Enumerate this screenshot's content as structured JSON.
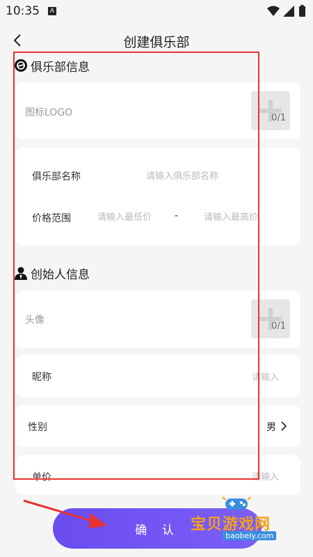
{
  "status_bar": {
    "time": "10:35",
    "notification_icon": "A"
  },
  "nav": {
    "title": "创建俱乐部"
  },
  "club_section": {
    "title": "俱乐部信息",
    "logo_label": "图标LOGO",
    "logo_count": "0/1",
    "name_label": "俱乐部名称",
    "name_placeholder": "请输入俱乐部名称",
    "price_label": "价格范围",
    "price_min_placeholder": "请输入最低价",
    "price_separator": "-",
    "price_max_placeholder": "请输入最高价"
  },
  "founder_section": {
    "title": "创始人信息",
    "avatar_label": "头像",
    "avatar_count": "0/1",
    "nickname_label": "昵称",
    "nickname_placeholder": "请输入",
    "gender_label": "性别",
    "gender_value": "男",
    "unit_price_label": "单价",
    "unit_price_placeholder": "请输入"
  },
  "confirm_label": "确 认",
  "watermark": {
    "main": "宝贝游戏网",
    "sub": "baobeiy.com"
  },
  "colors": {
    "accent": "#6a4cf0",
    "highlight": "#e8322f",
    "watermark": "#f4a11a"
  }
}
